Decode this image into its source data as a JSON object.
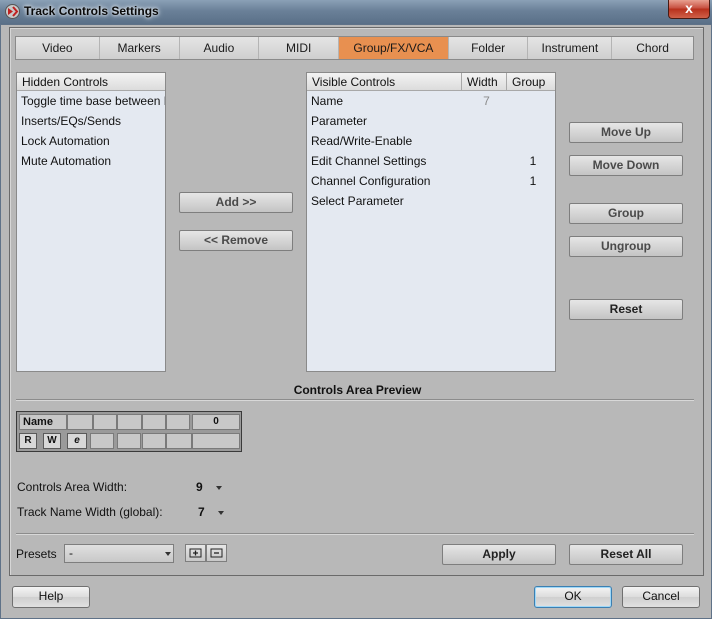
{
  "window": {
    "title": "Track Controls Settings",
    "close_glyph": "x"
  },
  "tabs": [
    {
      "label": "Video"
    },
    {
      "label": "Markers"
    },
    {
      "label": "Audio"
    },
    {
      "label": "MIDI"
    },
    {
      "label": "Group/FX/VCA",
      "active": true
    },
    {
      "label": "Folder"
    },
    {
      "label": "Instrument"
    },
    {
      "label": "Chord"
    }
  ],
  "hidden_controls": {
    "header": "Hidden Controls",
    "items": [
      "Toggle time base between Musical and Linear",
      "Inserts/EQs/Sends",
      "Lock Automation",
      "Mute Automation"
    ]
  },
  "visible_controls": {
    "headers": {
      "name": "Visible Controls",
      "width": "Width",
      "group": "Group"
    },
    "rows": [
      {
        "name": "Name",
        "width": "7",
        "group": ""
      },
      {
        "name": "Parameter",
        "width": "",
        "group": ""
      },
      {
        "name": "Read/Write-Enable",
        "width": "",
        "group": ""
      },
      {
        "name": "Edit Channel Settings",
        "width": "",
        "group": "1"
      },
      {
        "name": "Channel Configuration",
        "width": "",
        "group": "1"
      },
      {
        "name": "Select Parameter",
        "width": "",
        "group": ""
      }
    ]
  },
  "buttons": {
    "add": "Add >>",
    "remove": "<< Remove",
    "move_up": "Move Up",
    "move_down": "Move Down",
    "group": "Group",
    "ungroup": "Ungroup",
    "reset": "Reset",
    "apply": "Apply",
    "reset_all": "Reset All",
    "help": "Help",
    "ok": "OK",
    "cancel": "Cancel"
  },
  "preview": {
    "title": "Controls Area Preview",
    "name_label": "Name",
    "name_value": "0",
    "btn_read": "R",
    "btn_write": "W",
    "btn_edit": "e"
  },
  "settings": {
    "controls_area_width_label": "Controls Area Width:",
    "controls_area_width_value": "9",
    "track_name_width_label": "Track Name Width (global):",
    "track_name_width_value": "7"
  },
  "presets": {
    "label": "Presets",
    "value": "-"
  },
  "colors": {
    "active_tab": "#e89050",
    "list_bg": "#e4e9f1",
    "dialog_bg": "#b8b8b8"
  }
}
